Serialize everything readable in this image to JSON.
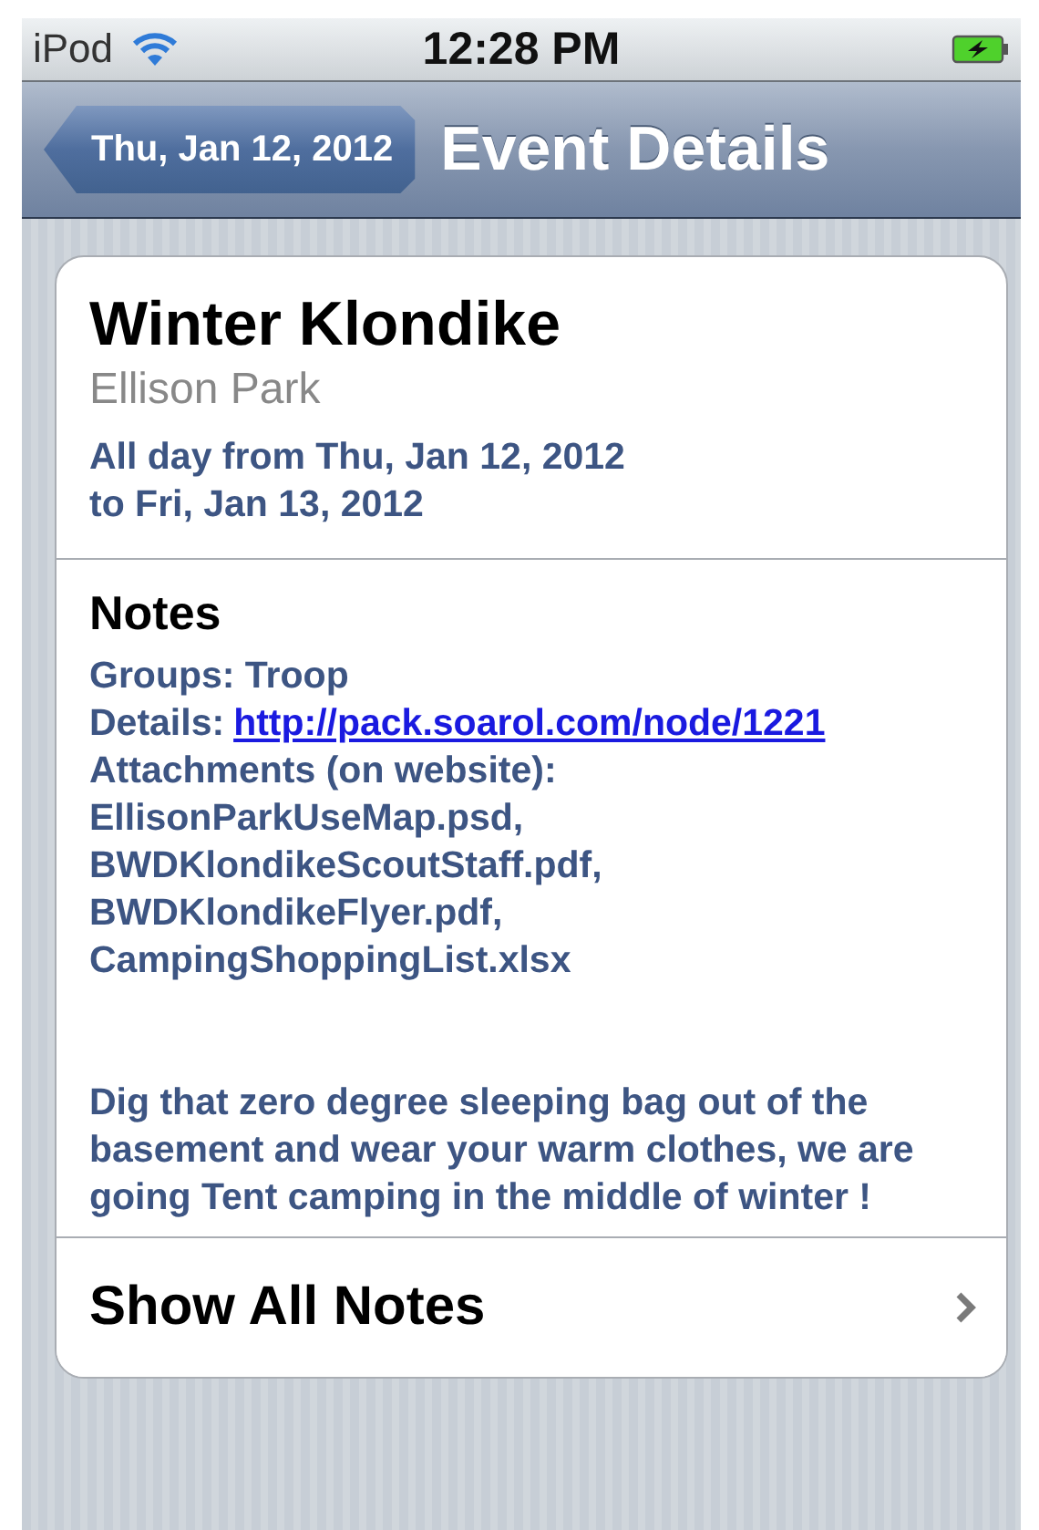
{
  "status_bar": {
    "carrier": "iPod",
    "time": "12:28 PM",
    "charging": true
  },
  "nav_bar": {
    "back_button": "Thu, Jan 12, 2012",
    "title": "Event Details"
  },
  "event": {
    "title": "Winter Klondike",
    "location": "Ellison Park",
    "date_lines": [
      "All day from Thu, Jan 12, 2012",
      "to Fri, Jan 13, 2012"
    ]
  },
  "notes": {
    "heading": "Notes",
    "lines": [
      {
        "kind": "text",
        "text": "Groups: Troop"
      },
      {
        "kind": "link",
        "label": "Details:",
        "url": "http://pack.soarol.com/node/1221"
      },
      {
        "kind": "text",
        "text": "Attachments (on website):"
      },
      {
        "kind": "text",
        "text": "EllisonParkUseMap.psd,"
      },
      {
        "kind": "text",
        "text": "BWDKlondikeScoutStaff.pdf,"
      },
      {
        "kind": "text",
        "text": "BWDKlondikeFlyer.pdf,"
      },
      {
        "kind": "text",
        "text": "CampingShoppingList.xlsx"
      }
    ],
    "paragraph": "Dig that zero degree sleeping bag out of the basement and wear your warm clothes, we are going Tent camping in the middle of winter !"
  },
  "show_all_button": "Show All Notes"
}
